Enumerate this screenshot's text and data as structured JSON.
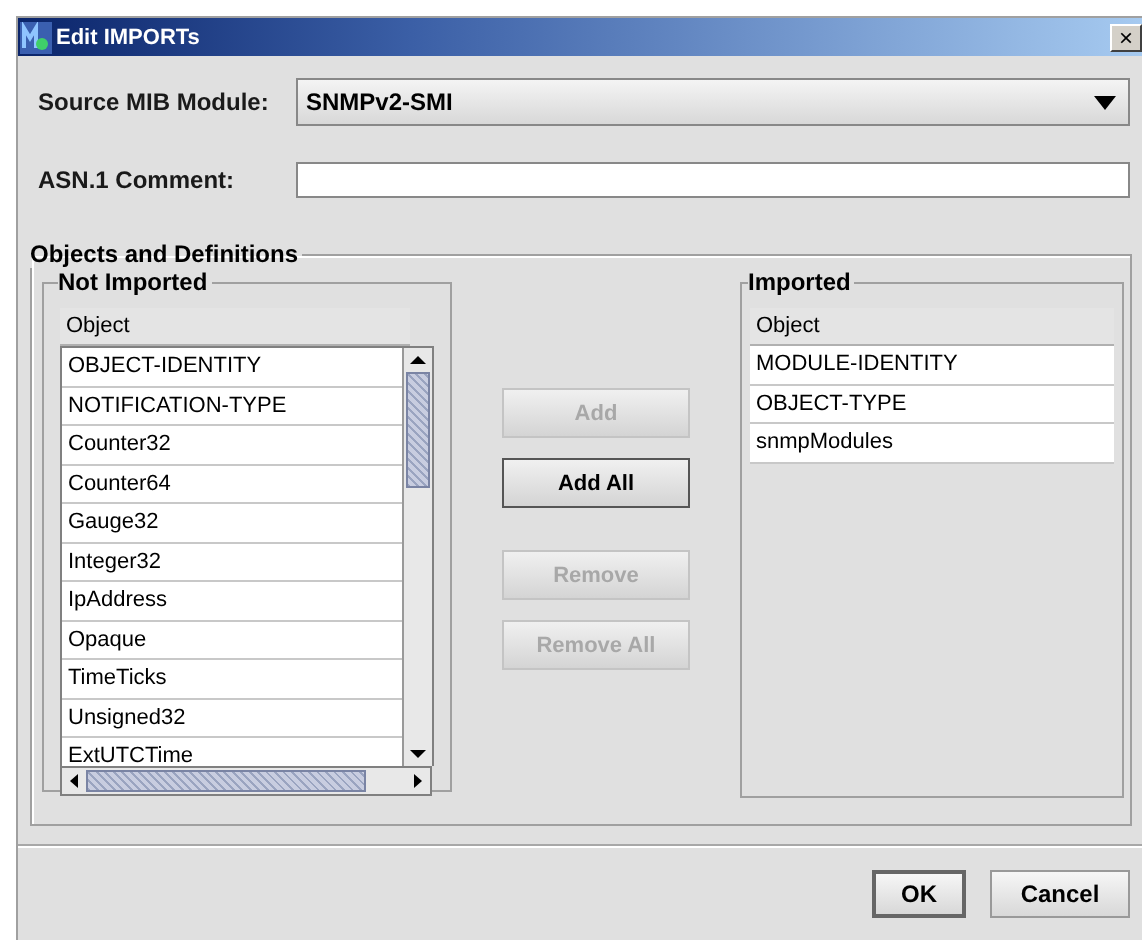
{
  "window": {
    "title": "Edit IMPORTs",
    "close": "×"
  },
  "source_module": {
    "label": "Source MIB Module:",
    "value": "SNMPv2-SMI"
  },
  "comment": {
    "label": "ASN.1 Comment:"
  },
  "group": {
    "title": "Objects and Definitions"
  },
  "not_imported": {
    "title": "Not Imported",
    "column": "Object",
    "rows": [
      "OBJECT-IDENTITY",
      "NOTIFICATION-TYPE",
      "Counter32",
      "Counter64",
      "Gauge32",
      "Integer32",
      "IpAddress",
      "Opaque",
      "TimeTicks",
      "Unsigned32",
      "ExtUTCTime"
    ]
  },
  "actions": [
    {
      "label": "Add",
      "disabled": true
    },
    {
      "label": "Add All",
      "disabled": false
    },
    {
      "label": "Remove",
      "disabled": true
    },
    {
      "label": "Remove All",
      "disabled": true
    }
  ],
  "imported": {
    "title": "Imported",
    "column": "Object",
    "rows": [
      "MODULE-IDENTITY",
      "OBJECT-TYPE",
      "snmpModules"
    ]
  },
  "buttons": [
    {
      "label": "OK",
      "default": true
    },
    {
      "label": "Cancel",
      "default": false
    }
  ]
}
